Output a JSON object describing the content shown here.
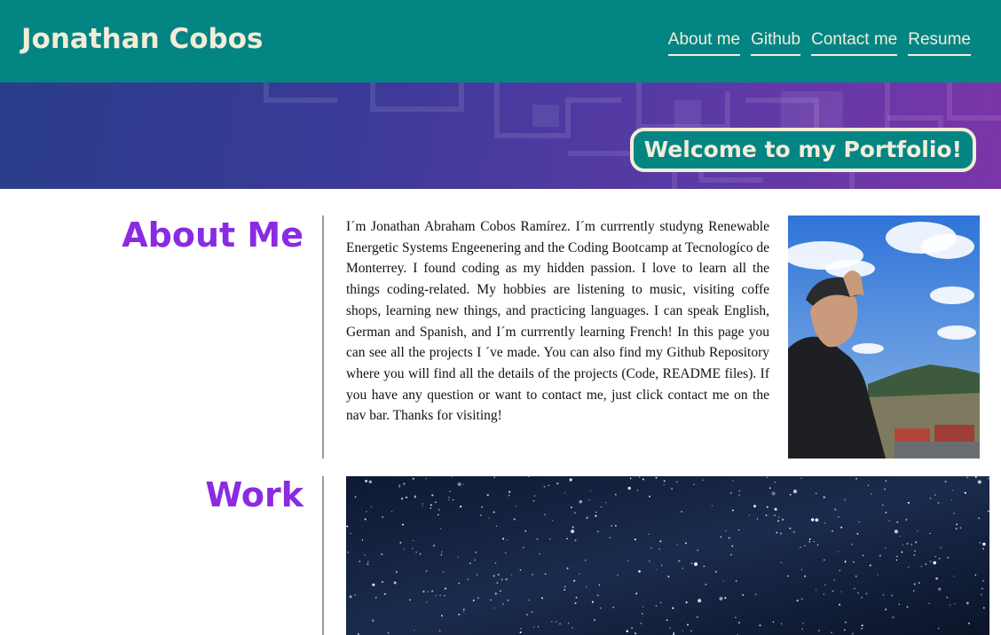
{
  "header": {
    "brand": "Jonathan Cobos",
    "nav": [
      "About me",
      "Github",
      "Contact me",
      "Resume"
    ]
  },
  "hero": {
    "welcome": "Welcome to my Portfolio!"
  },
  "about": {
    "title": "About Me",
    "text": "I´m Jonathan Abraham Cobos Ramírez. I´m currrently studyng Renewable Energetic Systems Engeenering and the Coding Bootcamp at Tecnologíco de Monterrey. I found coding as my hidden passion. I love to learn all the things coding-related. My hobbies are listening to music, visiting coffe shops, learning new things, and practicing languages. I can speak English, German and Spanish, and I´m currrently learning French! In this page you can see all the projects I ´ve made. You can also find my Github Repository where you will find all the details of the projects (Code, README files). If you have any question or want to contact me, just click contact me on the nav bar. Thanks for visiting!"
  },
  "work": {
    "title": "Work"
  },
  "colors": {
    "header_bg": "#038584",
    "accent_text": "#f5ecd7",
    "section_title": "#8a2be2"
  }
}
